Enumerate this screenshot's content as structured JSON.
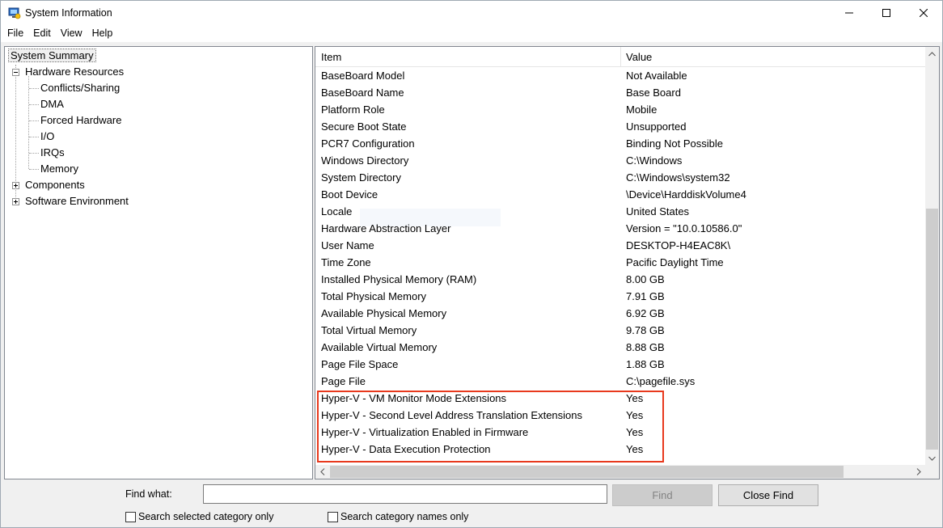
{
  "window": {
    "title": "System Information",
    "app_icon": "system-info-icon"
  },
  "menu": [
    "File",
    "Edit",
    "View",
    "Help"
  ],
  "tree": {
    "root": "System Summary",
    "hardware_resources": "Hardware Resources",
    "hardware_children": [
      "Conflicts/Sharing",
      "DMA",
      "Forced Hardware",
      "I/O",
      "IRQs",
      "Memory"
    ],
    "components": "Components",
    "software_environment": "Software Environment"
  },
  "list": {
    "columns": [
      "Item",
      "Value"
    ],
    "rows": [
      {
        "item": "BaseBoard Model",
        "value": "Not Available"
      },
      {
        "item": "BaseBoard Name",
        "value": "Base Board"
      },
      {
        "item": "Platform Role",
        "value": "Mobile"
      },
      {
        "item": "Secure Boot State",
        "value": "Unsupported"
      },
      {
        "item": "PCR7 Configuration",
        "value": "Binding Not Possible"
      },
      {
        "item": "Windows Directory",
        "value": "C:\\Windows"
      },
      {
        "item": "System Directory",
        "value": "C:\\Windows\\system32"
      },
      {
        "item": "Boot Device",
        "value": "\\Device\\HarddiskVolume4"
      },
      {
        "item": "Locale",
        "value": "United States"
      },
      {
        "item": "Hardware Abstraction Layer",
        "value": "Version = \"10.0.10586.0\""
      },
      {
        "item": "User Name",
        "value": "DESKTOP-H4EAC8K\\"
      },
      {
        "item": "Time Zone",
        "value": "Pacific Daylight Time"
      },
      {
        "item": "Installed Physical Memory (RAM)",
        "value": "8.00 GB"
      },
      {
        "item": "Total Physical Memory",
        "value": "7.91 GB"
      },
      {
        "item": "Available Physical Memory",
        "value": "6.92 GB"
      },
      {
        "item": "Total Virtual Memory",
        "value": "9.78 GB"
      },
      {
        "item": "Available Virtual Memory",
        "value": "8.88 GB"
      },
      {
        "item": "Page File Space",
        "value": "1.88 GB"
      },
      {
        "item": "Page File",
        "value": "C:\\pagefile.sys"
      },
      {
        "item": "Hyper-V - VM Monitor Mode Extensions",
        "value": "Yes"
      },
      {
        "item": "Hyper-V - Second Level Address Translation Extensions",
        "value": "Yes"
      },
      {
        "item": "Hyper-V - Virtualization Enabled in Firmware",
        "value": "Yes"
      },
      {
        "item": "Hyper-V - Data Execution Protection",
        "value": "Yes"
      }
    ],
    "highlight_color": "#e8391d"
  },
  "find": {
    "label": "Find what:",
    "value": "",
    "find_button": "Find",
    "close_find_button": "Close Find",
    "search_selected": "Search selected category only",
    "search_names": "Search category names only"
  }
}
